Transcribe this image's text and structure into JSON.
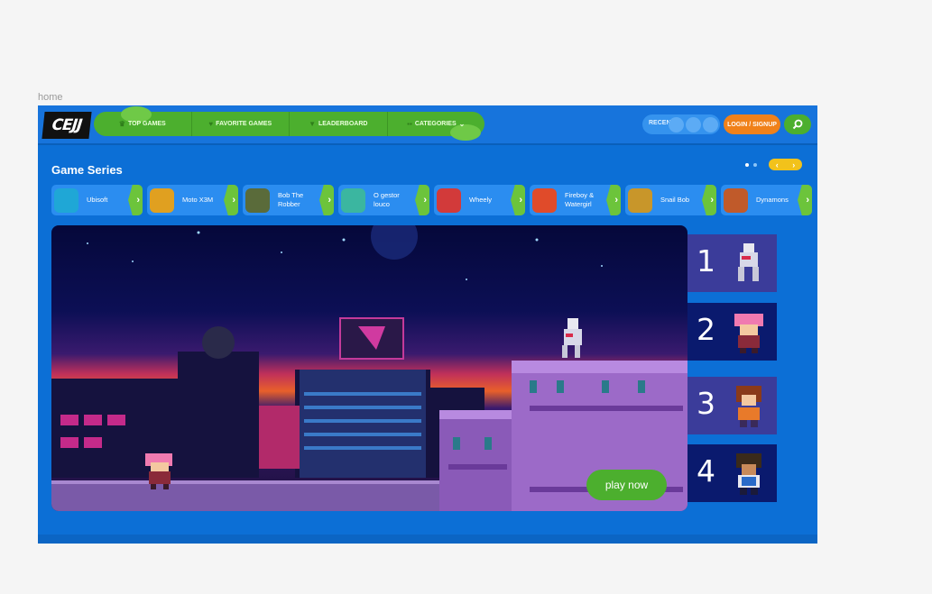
{
  "frame_label": "home",
  "logo": "CEJJ",
  "nav": [
    {
      "label": "TOP GAMES",
      "icon": "crown-icon"
    },
    {
      "label": "FAVORITE GAMES",
      "icon": "heart-icon"
    },
    {
      "label": "LEADERBOARD",
      "icon": "trophy-icon"
    },
    {
      "label": "CATEGORIES",
      "icon": "grid-icon"
    }
  ],
  "recent_label": "RECENT",
  "login_label": "LOGIN / SIGNUP",
  "series_title": "Game Series",
  "series": [
    {
      "name": "Ubisoft",
      "thumb_color": "#1fa7d6"
    },
    {
      "name": "Moto X3M",
      "thumb_color": "#e0a020"
    },
    {
      "name": "Bob The Robber",
      "thumb_color": "#5a6b3a"
    },
    {
      "name": "O gestor louco",
      "thumb_color": "#3bb6a0"
    },
    {
      "name": "Wheely",
      "thumb_color": "#d23a3a"
    },
    {
      "name": "Fireboy & Watergirl",
      "thumb_color": "#e04b2a"
    },
    {
      "name": "Snail Bob",
      "thumb_color": "#c8962a"
    },
    {
      "name": "Dynamons",
      "thumb_color": "#c05a2a"
    }
  ],
  "play_label": "play now",
  "ranking": [
    {
      "num": "1",
      "bg": "#3b3c9a"
    },
    {
      "num": "2",
      "bg": "#0a1a6e"
    },
    {
      "num": "3",
      "bg": "#3b3c9a"
    },
    {
      "num": "4",
      "bg": "#0a1a6e"
    }
  ],
  "colors": {
    "site_bg": "#0c6fd6",
    "nav_green": "#4caf2e",
    "login_orange": "#f0811a",
    "arrow_yellow": "#f2c21b"
  }
}
